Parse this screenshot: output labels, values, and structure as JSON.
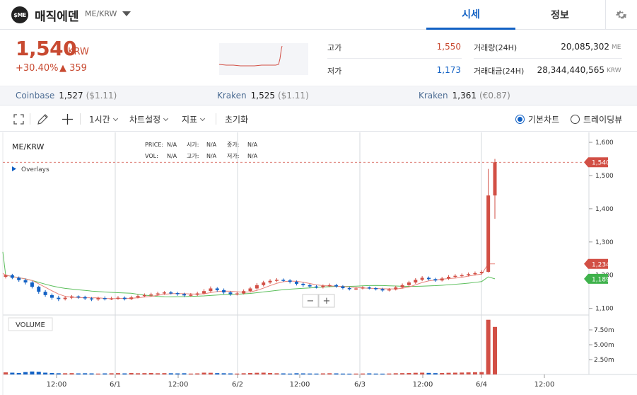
{
  "header": {
    "logo_text": "$ME",
    "coin_name": "매직에덴",
    "pair": "ME/KRW",
    "tabs": [
      {
        "label": "시세",
        "active": true
      },
      {
        "label": "정보",
        "active": false
      }
    ]
  },
  "price": {
    "current": "1,540",
    "unit": "KRW",
    "change_rate": "+30.40%",
    "change_amount": "▲ 359",
    "up_color": "#c84a31",
    "down_color": "#1261c4"
  },
  "stats": {
    "high_label": "고가",
    "high_value": "1,550",
    "low_label": "저가",
    "low_value": "1,173",
    "volume_label": "거래량(24H)",
    "volume_value": "20,085,302",
    "volume_unit": "ME",
    "amount_label": "거래대금(24H)",
    "amount_value": "28,344,440,565",
    "amount_unit": "KRW"
  },
  "exchanges": [
    {
      "name": "Coinbase",
      "price": "1,527",
      "sub": "($1.11)"
    },
    {
      "name": "Kraken",
      "price": "1,525",
      "sub": "($1.11)"
    },
    {
      "name": "Kraken",
      "price": "1,361",
      "sub": "(€0.87)"
    }
  ],
  "toolbar": {
    "interval": "1시간",
    "chart_settings": "차트설정",
    "indicators": "지표",
    "reset": "초기화",
    "basic_chart": "기본차트",
    "tradingview": "트레이딩뷰"
  },
  "chart_legend": {
    "symbol": "ME/KRW",
    "overlays": "Overlays",
    "price_label": "PRICE:",
    "price_val": "N/A",
    "open_label": "시가:",
    "open_val": "N/A",
    "close_label": "종가:",
    "close_val": "N/A",
    "vol_label": "VOL:",
    "vol_val": "N/A",
    "high_label": "고가:",
    "high_val": "N/A",
    "low_label": "저가:",
    "low_val": "N/A",
    "volume_title": "VOLUME",
    "zoom_out": "−",
    "zoom_in": "+"
  },
  "chart_data": {
    "type": "candlestick",
    "y_ticks": [
      "1,600",
      "1,500",
      "1,400",
      "1,300",
      "1,200",
      "1,100"
    ],
    "y_tick_values": [
      1600,
      1500,
      1400,
      1300,
      1200,
      1100
    ],
    "ylim": [
      1080,
      1630
    ],
    "x_ticks": [
      "12:00",
      "6/1",
      "12:00",
      "6/2",
      "12:00",
      "6/3",
      "12:00",
      "6/4",
      "12:00"
    ],
    "price_tags": [
      {
        "label": "1,540",
        "value": 1540,
        "color": "#d24f45"
      },
      {
        "label": "1,234",
        "value": 1234,
        "color": "#d24f45"
      },
      {
        "label": "1,189",
        "value": 1189,
        "color": "#3fb24c"
      }
    ],
    "volume_ticks": [
      "7.50m",
      "5.00m",
      "2.50m"
    ],
    "volume_tick_values": [
      7.5,
      5.0,
      2.5
    ],
    "volume_ylim": [
      0,
      10
    ],
    "candles": [
      [
        1195,
        1200,
        1190,
        1203
      ],
      [
        1200,
        1192,
        1188,
        1204
      ],
      [
        1192,
        1185,
        1180,
        1196
      ],
      [
        1185,
        1178,
        1172,
        1190
      ],
      [
        1178,
        1165,
        1160,
        1182
      ],
      [
        1165,
        1150,
        1144,
        1168
      ],
      [
        1150,
        1140,
        1135,
        1155
      ],
      [
        1140,
        1132,
        1126,
        1145
      ],
      [
        1132,
        1128,
        1122,
        1138
      ],
      [
        1128,
        1132,
        1124,
        1136
      ],
      [
        1132,
        1136,
        1128,
        1140
      ],
      [
        1136,
        1134,
        1129,
        1139
      ],
      [
        1134,
        1130,
        1125,
        1138
      ],
      [
        1130,
        1127,
        1122,
        1134
      ],
      [
        1127,
        1131,
        1123,
        1135
      ],
      [
        1131,
        1129,
        1124,
        1136
      ],
      [
        1129,
        1130,
        1125,
        1135
      ],
      [
        1130,
        1132,
        1126,
        1137
      ],
      [
        1132,
        1128,
        1124,
        1136
      ],
      [
        1128,
        1133,
        1125,
        1138
      ],
      [
        1133,
        1137,
        1130,
        1142
      ],
      [
        1137,
        1140,
        1134,
        1145
      ],
      [
        1140,
        1142,
        1136,
        1147
      ],
      [
        1142,
        1145,
        1138,
        1150
      ],
      [
        1145,
        1148,
        1141,
        1152
      ],
      [
        1148,
        1146,
        1142,
        1152
      ],
      [
        1146,
        1143,
        1138,
        1150
      ],
      [
        1143,
        1139,
        1134,
        1147
      ],
      [
        1139,
        1141,
        1135,
        1146
      ],
      [
        1141,
        1145,
        1137,
        1150
      ],
      [
        1145,
        1152,
        1142,
        1158
      ],
      [
        1152,
        1160,
        1149,
        1166
      ],
      [
        1160,
        1155,
        1150,
        1164
      ],
      [
        1155,
        1148,
        1143,
        1160
      ],
      [
        1148,
        1143,
        1138,
        1152
      ],
      [
        1143,
        1145,
        1139,
        1150
      ],
      [
        1145,
        1152,
        1142,
        1157
      ],
      [
        1152,
        1160,
        1148,
        1165
      ],
      [
        1160,
        1170,
        1156,
        1176
      ],
      [
        1170,
        1178,
        1166,
        1183
      ],
      [
        1178,
        1183,
        1174,
        1188
      ],
      [
        1183,
        1186,
        1179,
        1191
      ],
      [
        1186,
        1184,
        1180,
        1190
      ],
      [
        1184,
        1180,
        1175,
        1188
      ],
      [
        1180,
        1174,
        1169,
        1184
      ],
      [
        1174,
        1170,
        1165,
        1178
      ],
      [
        1170,
        1166,
        1162,
        1174
      ],
      [
        1166,
        1164,
        1160,
        1170
      ],
      [
        1164,
        1168,
        1160,
        1172
      ],
      [
        1168,
        1170,
        1164,
        1175
      ],
      [
        1170,
        1166,
        1162,
        1174
      ],
      [
        1166,
        1161,
        1157,
        1170
      ],
      [
        1161,
        1158,
        1154,
        1165
      ],
      [
        1158,
        1160,
        1155,
        1164
      ],
      [
        1160,
        1163,
        1157,
        1167
      ],
      [
        1163,
        1161,
        1157,
        1166
      ],
      [
        1161,
        1158,
        1154,
        1164
      ],
      [
        1158,
        1154,
        1150,
        1162
      ],
      [
        1154,
        1157,
        1151,
        1161
      ],
      [
        1157,
        1163,
        1154,
        1168
      ],
      [
        1163,
        1170,
        1160,
        1175
      ],
      [
        1170,
        1178,
        1167,
        1183
      ],
      [
        1178,
        1186,
        1174,
        1191
      ],
      [
        1186,
        1192,
        1182,
        1197
      ],
      [
        1192,
        1188,
        1184,
        1196
      ],
      [
        1188,
        1184,
        1180,
        1192
      ],
      [
        1184,
        1190,
        1181,
        1195
      ],
      [
        1190,
        1195,
        1186,
        1200
      ],
      [
        1195,
        1198,
        1191,
        1203
      ],
      [
        1198,
        1200,
        1194,
        1205
      ],
      [
        1200,
        1203,
        1196,
        1208
      ],
      [
        1203,
        1206,
        1199,
        1211
      ],
      [
        1206,
        1210,
        1202,
        1215
      ],
      [
        1210,
        1440,
        1208,
        1520
      ],
      [
        1440,
        1540,
        1370,
        1550
      ]
    ],
    "volumes": [
      0.35,
      0.3,
      0.25,
      0.4,
      0.5,
      0.45,
      0.3,
      0.25,
      0.2,
      0.2,
      0.22,
      0.18,
      0.2,
      0.18,
      0.15,
      0.18,
      0.2,
      0.22,
      0.18,
      0.25,
      0.2,
      0.22,
      0.25,
      0.2,
      0.22,
      0.2,
      0.18,
      0.2,
      0.15,
      0.18,
      0.3,
      0.28,
      0.22,
      0.2,
      0.18,
      0.15,
      0.2,
      0.25,
      0.28,
      0.3,
      0.25,
      0.2,
      0.18,
      0.15,
      0.2,
      0.18,
      0.16,
      0.15,
      0.18,
      0.2,
      0.18,
      0.15,
      0.14,
      0.15,
      0.16,
      0.18,
      0.15,
      0.14,
      0.16,
      0.2,
      0.22,
      0.25,
      0.28,
      0.3,
      0.26,
      0.22,
      0.25,
      0.28,
      0.3,
      0.32,
      0.35,
      0.38,
      0.4,
      9.2,
      8.0
    ]
  }
}
